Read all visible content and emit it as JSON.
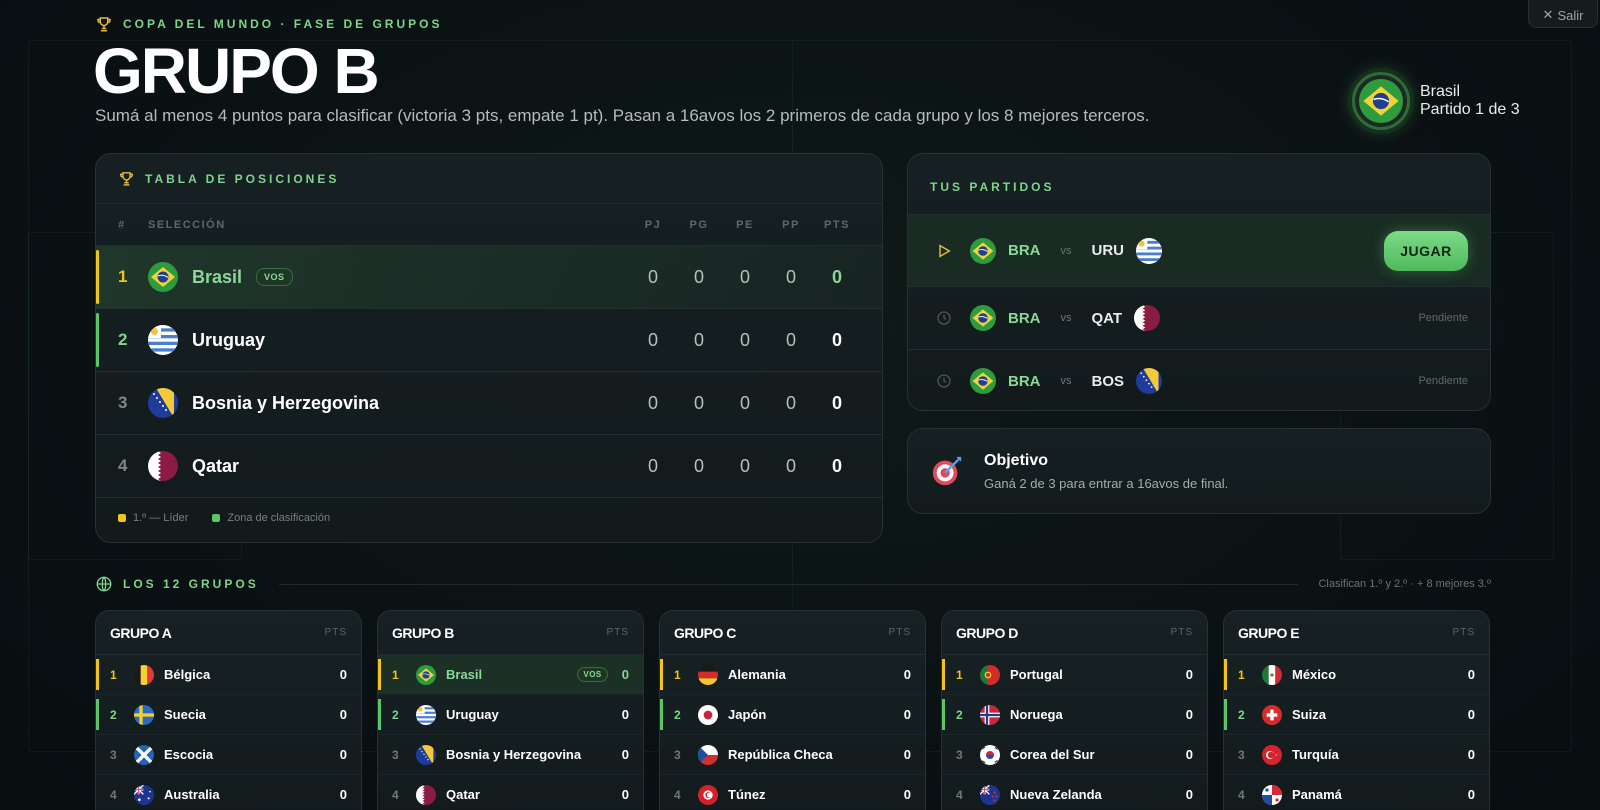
{
  "header": {
    "eyebrow": "COPA DEL MUNDO · FASE DE GRUPOS",
    "title": "GRUPO B",
    "subtitle": "Sumá al menos 4 puntos para clasificar (victoria 3 pts, empate 1 pt). Pasan a 16avos los 2 primeros de cada grupo y los 8 mejores terceros.",
    "exit_label": "Salir"
  },
  "team_badge": {
    "name": "Brasil",
    "sub": "Partido 1 de 3"
  },
  "standings": {
    "title": "TABLA DE POSICIONES",
    "columns": {
      "num": "#",
      "team": "SELECCIÓN",
      "pj": "PJ",
      "pg": "PG",
      "pe": "PE",
      "pp": "PP",
      "pts": "PTS"
    },
    "rows": [
      {
        "pos": "1",
        "team": "Brasil",
        "tag": "VOS",
        "pj": "0",
        "pg": "0",
        "pe": "0",
        "pp": "0",
        "pts": "0"
      },
      {
        "pos": "2",
        "team": "Uruguay",
        "pj": "0",
        "pg": "0",
        "pe": "0",
        "pp": "0",
        "pts": "0"
      },
      {
        "pos": "3",
        "team": "Bosnia y Herzegovina",
        "pj": "0",
        "pg": "0",
        "pe": "0",
        "pp": "0",
        "pts": "0"
      },
      {
        "pos": "4",
        "team": "Qatar",
        "pj": "0",
        "pg": "0",
        "pe": "0",
        "pp": "0",
        "pts": "0"
      }
    ],
    "legend": {
      "leader": "1.º — Líder",
      "qualify": "Zona de clasificación"
    },
    "colors": {
      "leader": "#f0c419",
      "qualify": "#5cc46a"
    }
  },
  "matches": {
    "title": "TUS PARTIDOS",
    "vs": "vs",
    "items": [
      {
        "home": "BRA",
        "away": "URU",
        "action": "JUGAR"
      },
      {
        "home": "BRA",
        "away": "QAT",
        "status": "Pendiente"
      },
      {
        "home": "BRA",
        "away": "BOS",
        "status": "Pendiente"
      }
    ]
  },
  "objective": {
    "title": "Objetivo",
    "desc": "Ganá 2 de 3 para entrar a 16avos de final."
  },
  "groups": {
    "title": "LOS 12 GRUPOS",
    "note": "Clasifican 1.º y 2.º · + 8 mejores 3.º",
    "pts_label": "PTS",
    "vos_label": "VOS",
    "cards": [
      {
        "name": "GRUPO A",
        "teams": [
          {
            "pos": "1",
            "name": "Bélgica",
            "pts": "0"
          },
          {
            "pos": "2",
            "name": "Suecia",
            "pts": "0"
          },
          {
            "pos": "3",
            "name": "Escocia",
            "pts": "0"
          },
          {
            "pos": "4",
            "name": "Australia",
            "pts": "0"
          }
        ]
      },
      {
        "name": "GRUPO B",
        "teams": [
          {
            "pos": "1",
            "name": "Brasil",
            "pts": "0"
          },
          {
            "pos": "2",
            "name": "Uruguay",
            "pts": "0"
          },
          {
            "pos": "3",
            "name": "Bosnia y Herzegovina",
            "pts": "0"
          },
          {
            "pos": "4",
            "name": "Qatar",
            "pts": "0"
          }
        ]
      },
      {
        "name": "GRUPO C",
        "teams": [
          {
            "pos": "1",
            "name": "Alemania",
            "pts": "0"
          },
          {
            "pos": "2",
            "name": "Japón",
            "pts": "0"
          },
          {
            "pos": "3",
            "name": "República Checa",
            "pts": "0"
          },
          {
            "pos": "4",
            "name": "Túnez",
            "pts": "0"
          }
        ]
      },
      {
        "name": "GRUPO D",
        "teams": [
          {
            "pos": "1",
            "name": "Portugal",
            "pts": "0"
          },
          {
            "pos": "2",
            "name": "Noruega",
            "pts": "0"
          },
          {
            "pos": "3",
            "name": "Corea del Sur",
            "pts": "0"
          },
          {
            "pos": "4",
            "name": "Nueva Zelanda",
            "pts": "0"
          }
        ]
      },
      {
        "name": "GRUPO E",
        "teams": [
          {
            "pos": "1",
            "name": "México",
            "pts": "0"
          },
          {
            "pos": "2",
            "name": "Suiza",
            "pts": "0"
          },
          {
            "pos": "3",
            "name": "Turquía",
            "pts": "0"
          },
          {
            "pos": "4",
            "name": "Panamá",
            "pts": "0"
          }
        ]
      }
    ]
  }
}
